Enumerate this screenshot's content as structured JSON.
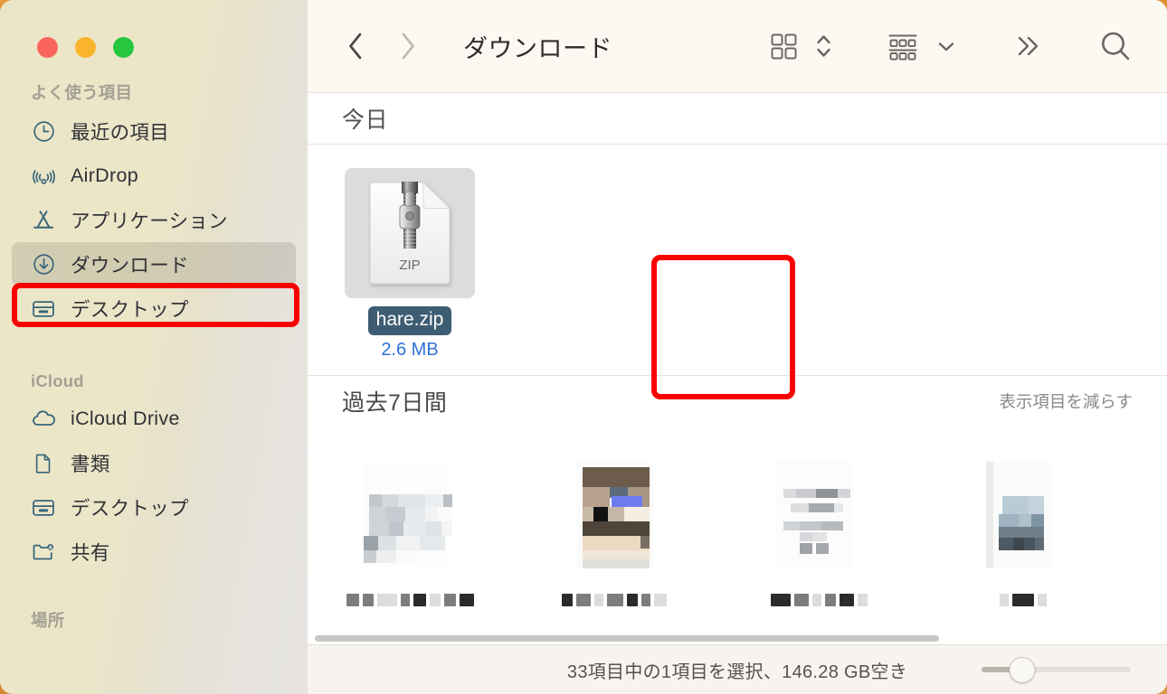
{
  "window": {
    "traffic_lights": [
      {
        "name": "close",
        "color": "#f9655c"
      },
      {
        "name": "minimize",
        "color": "#f9b42c"
      },
      {
        "name": "zoom",
        "color": "#26c73f"
      }
    ]
  },
  "sidebar": {
    "sections": [
      {
        "title": "よく使う項目",
        "items": [
          {
            "label": "最近の項目",
            "icon": "clock-icon",
            "selected": false
          },
          {
            "label": "AirDrop",
            "icon": "airdrop-icon",
            "selected": false
          },
          {
            "label": "アプリケーション",
            "icon": "applications-icon",
            "selected": false
          },
          {
            "label": "ダウンロード",
            "icon": "downloads-icon",
            "selected": true
          },
          {
            "label": "デスクトップ",
            "icon": "desktop-icon",
            "selected": false
          }
        ]
      },
      {
        "title": "iCloud",
        "items": [
          {
            "label": "iCloud Drive",
            "icon": "cloud-icon",
            "selected": false
          },
          {
            "label": "書類",
            "icon": "document-icon",
            "selected": false
          },
          {
            "label": "デスクトップ",
            "icon": "desktop-icon",
            "selected": false
          },
          {
            "label": "共有",
            "icon": "shared-folder-icon",
            "selected": false
          }
        ]
      },
      {
        "title": "場所",
        "items": []
      }
    ]
  },
  "toolbar": {
    "back_label": "戻る",
    "forward_label": "進む",
    "title": "ダウンロード",
    "icon_view_label": "アイコン表示",
    "sort_label": "グループ分け",
    "view_options_label": "表示オプション",
    "more_label": "その他",
    "search_label": "検索"
  },
  "content": {
    "groups": [
      {
        "title": "今日",
        "action": "",
        "files": [
          {
            "name": "hare.zip",
            "size": "2.6 MB",
            "icon": "zip-file-icon",
            "badge": "ZIP",
            "selected": true,
            "censored": false
          }
        ]
      },
      {
        "title": "過去7日間",
        "action": "表示項目を減らす",
        "files": [
          {
            "name": "",
            "size": "",
            "icon": "image-file-icon",
            "badge": "",
            "selected": false,
            "censored": true
          },
          {
            "name": "",
            "size": "",
            "icon": "image-file-icon",
            "badge": "",
            "selected": false,
            "censored": true
          },
          {
            "name": "",
            "size": "",
            "icon": "document-file-icon",
            "badge": "",
            "selected": false,
            "censored": true
          },
          {
            "name": "",
            "size": "",
            "icon": "image-file-icon",
            "badge": "",
            "selected": false,
            "censored": true
          }
        ]
      }
    ]
  },
  "statusbar": {
    "text": "33項目中の1項目を選択、146.28 GB空き",
    "zoom_value": 27
  },
  "annotations": {
    "highlight_color": "#fb0000",
    "boxes": [
      {
        "target": "sidebar-item-downloads"
      },
      {
        "target": "file-hare-zip"
      }
    ]
  },
  "colors": {
    "sidebar_bg": "#ece6c9",
    "toolbar_bg": "#fcf8f2",
    "selection_label_bg": "#3e5d73",
    "file_size_text": "#2f72d8",
    "desktop_bg": "#ef9b35"
  }
}
